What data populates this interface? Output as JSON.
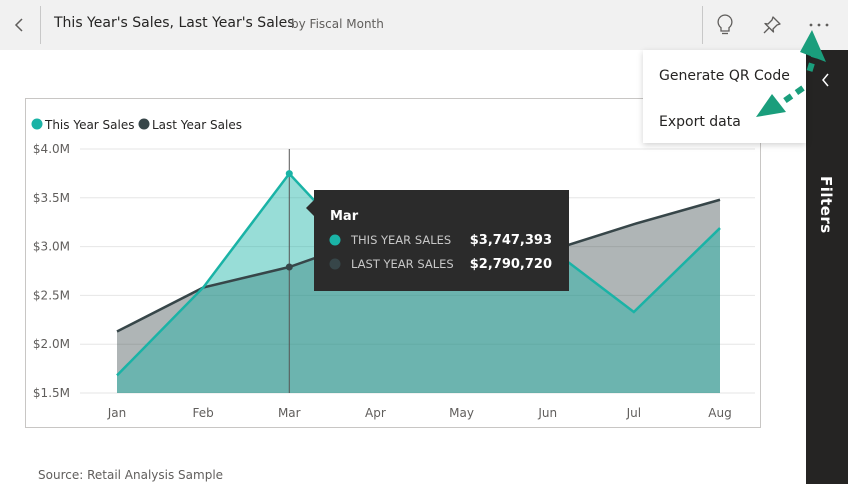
{
  "header": {
    "title": "This Year's Sales, Last Year's Sales",
    "subtitle": "by Fiscal Month",
    "back_icon": "chevron-left-icon",
    "insights_icon": "lightbulb-icon",
    "pin_icon": "pin-icon",
    "more_icon": "more-options-icon"
  },
  "menu": {
    "items": [
      {
        "label": "Generate QR Code"
      },
      {
        "label": "Export data"
      }
    ]
  },
  "filters": {
    "label": "Filters",
    "icon": "chevron-left-icon"
  },
  "colors": {
    "this_year": "#1ab3a6",
    "last_year": "#374649",
    "tooltip_bg": "#2b2b2b",
    "annotation_arrow": "#1a9e7c",
    "filters_pane": "#252423"
  },
  "chart_data": {
    "type": "area",
    "categories": [
      "Jan",
      "Feb",
      "Mar",
      "Apr",
      "May",
      "Jun",
      "Jul",
      "Aug"
    ],
    "series": [
      {
        "name": "This Year Sales",
        "values": [
          1680000,
          2580000,
          3747393,
          2800000,
          2850000,
          3000000,
          2330000,
          3190000
        ]
      },
      {
        "name": "Last Year Sales",
        "values": [
          2130000,
          2580000,
          2790720,
          3100000,
          2850000,
          2950000,
          3230000,
          3480000
        ]
      }
    ],
    "y_ticks": [
      "$4.0M",
      "$3.5M",
      "$3.0M",
      "$2.5M",
      "$2.0M",
      "$1.5M"
    ],
    "ylim": [
      1500000,
      4000000
    ],
    "grid": true,
    "legend_position": "top-left",
    "tooltip": {
      "category": "Mar",
      "rows": [
        {
          "label": "THIS YEAR SALES",
          "value": "$3,747,393"
        },
        {
          "label": "LAST YEAR SALES",
          "value": "$2,790,720"
        }
      ]
    },
    "source": "Source: Retail Analysis Sample"
  }
}
